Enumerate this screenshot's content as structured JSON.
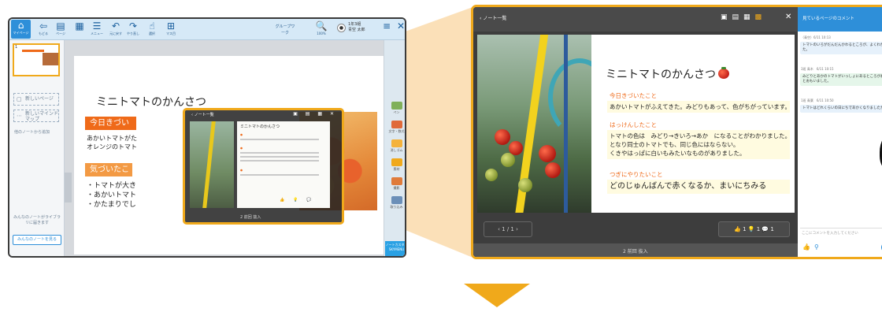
{
  "colors": {
    "accent": "#f0a91b",
    "toolbar": "#d6e9f7",
    "primary": "#2e8fd9",
    "heading_bar": "#ef6a19"
  },
  "app": {
    "toolbar": {
      "home_label": "マイページ",
      "items": [
        {
          "icon": "back-arrow-icon",
          "glyph": "⇦",
          "label": "もどる"
        },
        {
          "icon": "page-icon",
          "glyph": "▤",
          "label": "ページ"
        },
        {
          "icon": "page-active-icon",
          "glyph": "▦",
          "label": ""
        },
        {
          "icon": "menu-icon",
          "glyph": "☰",
          "label": "メニュー"
        },
        {
          "icon": "undo-icon",
          "glyph": "↶",
          "label": "元に戻す"
        },
        {
          "icon": "redo-icon",
          "glyph": "↷",
          "label": "やり直し"
        },
        {
          "icon": "select-icon",
          "glyph": "☝",
          "label": "選択"
        },
        {
          "icon": "grid-icon",
          "glyph": "⊞",
          "label": "マス目"
        }
      ],
      "group_work": "グループワーク",
      "zoom": "100%",
      "user_class": "1年3組",
      "user_name": "青空 太郎"
    },
    "left_panel": {
      "page_number": "1",
      "new_page": "新しいページ",
      "new_thinking": "新しいマインドマップ",
      "from_other": "他のノートから追加",
      "notes_notice": "みんなのノートがライブラリに届きます",
      "notes_button": "みんなのノートを見る"
    },
    "sheet": {
      "title": "ミニトマトのかんさつ",
      "head1": "今日きづいたこと",
      "text1a": "あかいトマトがた",
      "text1b": "オレンジのトマト",
      "head2": "気づいたこと",
      "bullet1": "・トマトが大き",
      "bullet2": "・あかいトマト",
      "bullet3": "・かたまりでし"
    },
    "overlay": {
      "title": "ノート一覧",
      "tools": "▣ ▤ ▦ ✕",
      "doc_title": "ミニトマトのかんさつ",
      "reactions": "👍1 💡1 💬1",
      "footer": "2 前回 抜入"
    },
    "right_tools": [
      {
        "icon": "pen-icon",
        "label": "ペン"
      },
      {
        "icon": "text-icon",
        "label": "文字・数式"
      },
      {
        "icon": "eraser-icon",
        "label": "消しゴム"
      },
      {
        "icon": "folder-icon",
        "label": "素材"
      },
      {
        "icon": "camera-icon",
        "label": "撮影"
      },
      {
        "icon": "import-icon",
        "label": "取り込み"
      }
    ],
    "sky_menu": "ノートカスタム SKYMENU"
  },
  "viewer": {
    "back_label": "ノート一覧",
    "title": "ミニトマトのかんさつ",
    "sections": [
      {
        "heading": "今日きづいたこと",
        "body": [
          "あかいトマトがふえてきた。みどりもあって、色がちがっています。"
        ]
      },
      {
        "heading": "はっけんしたこと",
        "body": [
          "トマトの色は　みどり→きいろ→あか　になることがわかりました。",
          "となり同士のトマトでも、同じ色にはならない。",
          "くきやはっぱに白いもみたいなものがありました。"
        ]
      },
      {
        "heading": "つぎにやりたいこと",
        "body": [
          "どのじゅんばんで赤くなるか、まいにちみる"
        ]
      }
    ],
    "pager": "‹  1 / 1  ›",
    "reactions": "👍 1   💡 1   💬 1",
    "bottom_label": "2 前回 抜入"
  },
  "comments": {
    "header": "見ているページのコメント",
    "items": [
      {
        "meta": "（青空）6/11 10:13",
        "text": "トマトのいろがだんだんかわるところが、よくわかりました。"
      },
      {
        "meta": "3班 青木　6/11 10:15",
        "text": "みどりとあかのトマトがいっしょにあるところがおもしろいとおもいました。"
      },
      {
        "meta": "1班 青葉　6/11 10:50",
        "text": "トマトはどれくらいの日にちであかくなりましたか？"
      }
    ],
    "input_placeholder": "ここにコメントを入力してください",
    "send": "+"
  }
}
